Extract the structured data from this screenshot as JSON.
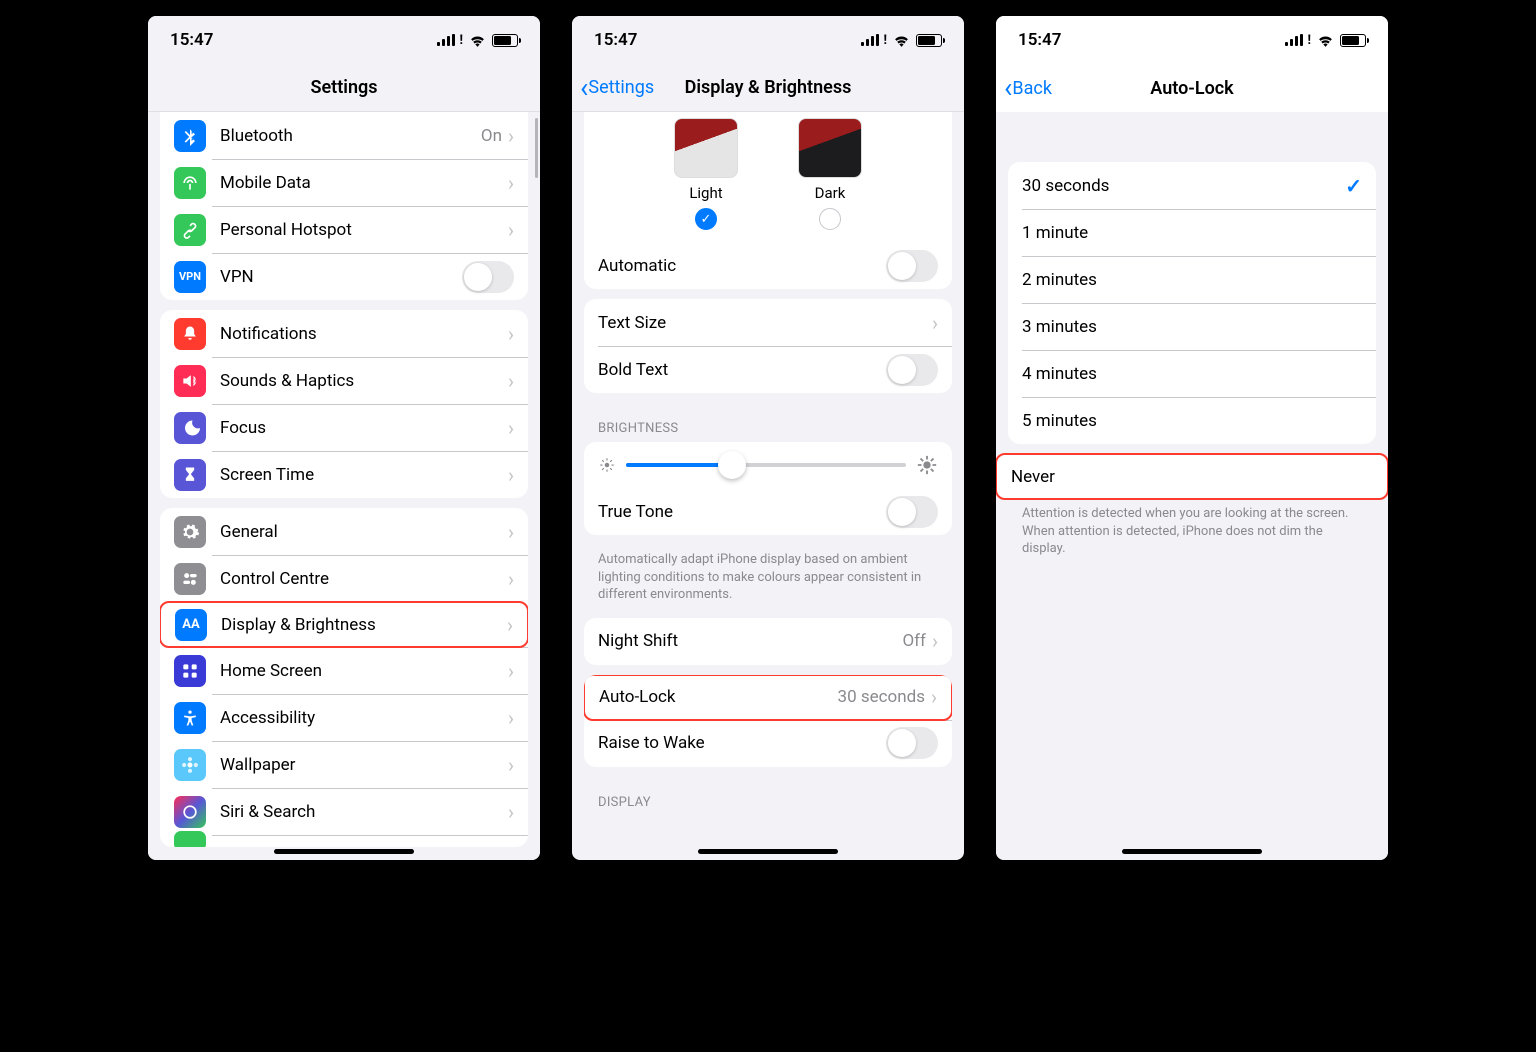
{
  "status": {
    "time": "15:47"
  },
  "screen1": {
    "title": "Settings",
    "rows": {
      "bluetooth": {
        "label": "Bluetooth",
        "value": "On"
      },
      "mobileData": {
        "label": "Mobile Data"
      },
      "hotspot": {
        "label": "Personal Hotspot"
      },
      "vpn": {
        "label": "VPN"
      },
      "notifications": {
        "label": "Notifications"
      },
      "sounds": {
        "label": "Sounds & Haptics"
      },
      "focus": {
        "label": "Focus"
      },
      "screenTime": {
        "label": "Screen Time"
      },
      "general": {
        "label": "General"
      },
      "controlCentre": {
        "label": "Control Centre"
      },
      "display": {
        "label": "Display & Brightness"
      },
      "homeScreen": {
        "label": "Home Screen"
      },
      "accessibility": {
        "label": "Accessibility"
      },
      "wallpaper": {
        "label": "Wallpaper"
      },
      "siri": {
        "label": "Siri & Search"
      }
    }
  },
  "screen2": {
    "back": "Settings",
    "title": "Display & Brightness",
    "appearance": {
      "light": "Light",
      "dark": "Dark"
    },
    "automatic": "Automatic",
    "textSize": "Text Size",
    "boldText": "Bold Text",
    "brightnessHdr": "BRIGHTNESS",
    "trueTone": "True Tone",
    "trueToneFooter": "Automatically adapt iPhone display based on ambient lighting conditions to make colours appear consistent in different environments.",
    "nightShift": {
      "label": "Night Shift",
      "value": "Off"
    },
    "autoLock": {
      "label": "Auto-Lock",
      "value": "30 seconds"
    },
    "raiseToWake": "Raise to Wake",
    "displayHdr": "DISPLAY"
  },
  "screen3": {
    "back": "Back",
    "title": "Auto-Lock",
    "options": {
      "o0": "30 seconds",
      "o1": "1 minute",
      "o2": "2 minutes",
      "o3": "3 minutes",
      "o4": "4 minutes",
      "o5": "5 minutes",
      "never": "Never"
    },
    "footer": "Attention is detected when you are looking at the screen. When attention is detected, iPhone does not dim the display."
  }
}
